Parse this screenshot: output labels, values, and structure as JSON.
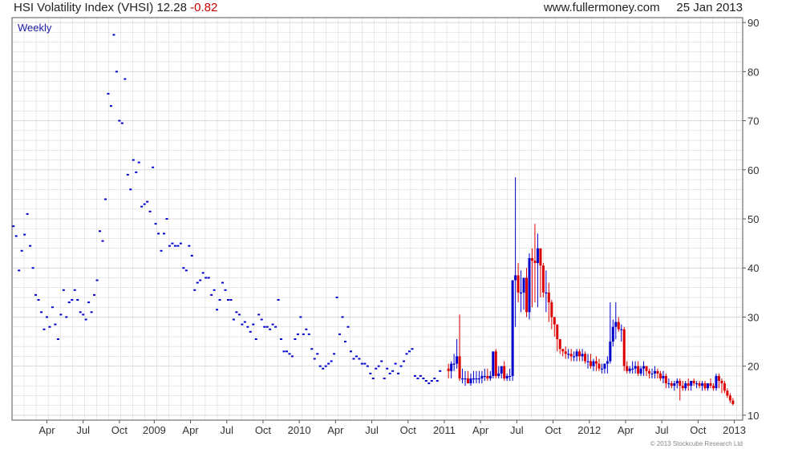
{
  "header": {
    "title": "HSI Volatility Index (VHSI)",
    "last": "12.28",
    "change": "-0.82",
    "source": "www.fullermoney.com",
    "date": "25 Jan 2013"
  },
  "footer": {
    "copyright": "© 2013 Stockcube Research Ltd"
  },
  "colors": {
    "up": "#0000cc",
    "down": "#dd0000",
    "grid": "#d8d8d8",
    "text": "#333333"
  },
  "chart_data": {
    "type": "candlestick",
    "title": "HSI Volatility Index (VHSI)",
    "subtitle": "Weekly",
    "y_axis": {
      "side": "right",
      "ylim": [
        9,
        91
      ],
      "ticks": [
        10,
        20,
        30,
        40,
        50,
        60,
        70,
        80,
        90
      ]
    },
    "x_axis": {
      "labels": [
        "Apr",
        "Jul",
        "Oct",
        "2009",
        "Apr",
        "Jul",
        "Oct",
        "2010",
        "Apr",
        "Jul",
        "Oct",
        "2011",
        "Apr",
        "Jul",
        "Oct",
        "2012",
        "Apr",
        "Jul",
        "Oct",
        "2013"
      ],
      "label_week": [
        12.5,
        25.5,
        38.5,
        51,
        64,
        77,
        90,
        103,
        116,
        129,
        142,
        155,
        168,
        181,
        194,
        207,
        220,
        233,
        246,
        259
      ]
    },
    "grid": true,
    "series_points": {
      "name": "VHSI weekly (point plot)",
      "week_start": 0,
      "values": [
        48.5,
        46.5,
        39.5,
        43.5,
        46.8,
        51,
        44.5,
        40,
        34.5,
        33.5,
        31,
        27.5,
        30,
        28,
        32,
        28.5,
        25.5,
        30.5,
        35.5,
        30,
        33,
        33.5,
        35.5,
        33.5,
        31,
        30.5,
        29.5,
        33,
        31,
        34.5,
        37.5,
        47.5,
        45.5,
        54,
        75.5,
        73,
        87.5,
        80,
        70,
        69.5,
        78.5,
        59,
        56,
        62,
        59.5,
        61.5,
        52.5,
        53,
        53.5,
        51.5,
        60.5,
        49,
        47,
        43.5,
        47,
        50,
        44.5,
        45,
        44.5,
        44.5,
        45,
        40,
        39.5,
        44.5,
        42.5,
        35.5,
        37,
        37.5,
        39,
        38,
        38,
        34.5,
        35.5,
        31.5,
        33.5,
        37,
        35.5,
        33.5,
        33.5,
        29.5,
        31,
        30.5,
        28.5,
        29,
        28,
        27,
        28.5,
        25.5,
        30.5,
        29.5,
        28,
        28,
        27.5,
        28.5,
        28,
        33.5,
        25.5,
        23,
        23,
        22.5,
        22,
        25.5,
        26.5,
        30,
        26.5,
        27.5,
        26.5,
        23.5,
        21.5,
        22.5,
        20,
        19.5,
        20,
        20.5,
        21,
        22.5,
        34,
        26.5,
        30,
        25,
        28,
        23,
        21.5,
        22,
        21.5,
        20.5,
        20.5,
        20,
        18.5,
        17.5,
        19.5,
        20,
        21,
        17.5,
        19.5,
        18.5,
        19,
        20.5,
        18.5,
        20,
        21,
        22.5,
        23,
        23.5,
        18,
        17.5,
        18,
        17.5,
        17,
        16.5,
        17,
        17.5,
        17,
        19
      ]
    },
    "series_candles": {
      "name": "VHSI weekly (OHLC)",
      "week_start": 156,
      "open": [
        19.5,
        19,
        20.5,
        20.5,
        22,
        17.5,
        17.5,
        17.5,
        16.5,
        17.5,
        17.5,
        17.5,
        17.5,
        18,
        18,
        17.5,
        18,
        23,
        18,
        18.5,
        20,
        17.5,
        18,
        18,
        37.5,
        38.5,
        35,
        35,
        38,
        31,
        42,
        41.5,
        41,
        44,
        40.5,
        35,
        35,
        33,
        30,
        28.5,
        25.5,
        23.5,
        23,
        22.5,
        22.5,
        22,
        22,
        23,
        22,
        22.5,
        21,
        21,
        20,
        21,
        20.5,
        19.5,
        19.5,
        20.5,
        21,
        25,
        28,
        29,
        27.5,
        27.5,
        20,
        19,
        19.5,
        19.5,
        20,
        18.5,
        19.5,
        20,
        19,
        18.5,
        18.5,
        19,
        18.5,
        17.5,
        18,
        16.5,
        16.5,
        16,
        16.5,
        17,
        16,
        15.5,
        16.5,
        16,
        17,
        16.5,
        16.5,
        16,
        16.5,
        15.5,
        16.5,
        16,
        15.5,
        18,
        17,
        16.5,
        15,
        14,
        13
      ],
      "high": [
        20.5,
        21,
        22.5,
        25.5,
        30.5,
        19.5,
        19,
        19,
        18.5,
        19,
        19,
        19,
        19,
        19.5,
        19.5,
        19,
        19.5,
        23.5,
        20,
        19.5,
        21,
        18.5,
        19.5,
        19.5,
        58.5,
        41,
        39.5,
        38,
        40,
        43,
        44,
        49,
        47,
        43.5,
        41,
        39.5,
        37,
        33.5,
        29,
        27,
        24.5,
        23.5,
        24,
        23.5,
        23.5,
        23,
        23.5,
        23.5,
        23.5,
        23,
        22.5,
        22.5,
        21.5,
        22,
        21.5,
        20.5,
        20.5,
        22,
        33,
        29.5,
        33,
        30,
        28.5,
        28,
        21,
        20,
        21,
        21,
        21,
        20,
        21,
        20,
        19.5,
        19.5,
        20,
        19.5,
        19,
        19,
        18.5,
        17.5,
        17,
        17,
        17.5,
        17.5,
        17,
        17,
        17.5,
        17,
        17.5,
        17,
        17,
        17,
        17,
        16.5,
        17.5,
        16.5,
        18.5,
        18.5,
        17.5,
        17,
        15.5,
        14.5,
        13.5
      ],
      "low": [
        17.5,
        17.5,
        19,
        19.5,
        17,
        16.5,
        16,
        16.5,
        16,
        16.5,
        16.5,
        16.5,
        16.5,
        17,
        17,
        17,
        17.5,
        17.5,
        17.5,
        17.5,
        17,
        17,
        17,
        17,
        28,
        33,
        31,
        31.5,
        30,
        29.5,
        32,
        33,
        32,
        34,
        34,
        31,
        29,
        27.5,
        26,
        23,
        22.5,
        22,
        21.5,
        21.5,
        21,
        21,
        21,
        21,
        21,
        20.5,
        19.5,
        19.5,
        19,
        19,
        19,
        18.5,
        18.5,
        18.5,
        20.5,
        24,
        25.5,
        27,
        25,
        19,
        18.5,
        18.5,
        18.5,
        18.5,
        18,
        18,
        18,
        18,
        17.5,
        17.5,
        17.5,
        17.5,
        17,
        16.5,
        15.5,
        15.5,
        15.5,
        15,
        15.5,
        13,
        15,
        15,
        15,
        15,
        16,
        15.5,
        15.5,
        15,
        15,
        15,
        15.5,
        15,
        15,
        15.5,
        14.5,
        14.5,
        13.5,
        12.5,
        12
      ],
      "close": [
        19,
        20.5,
        20.5,
        22,
        17.5,
        17.5,
        17.5,
        16.5,
        17.5,
        17.5,
        17.5,
        17.5,
        18,
        18,
        17.5,
        18,
        23,
        18,
        18.5,
        20,
        17.5,
        18,
        18,
        37.5,
        38.5,
        35,
        35,
        38,
        31,
        42,
        41.5,
        41,
        44,
        40.5,
        35,
        35,
        33,
        30,
        28.5,
        25.5,
        23.5,
        23,
        22.5,
        22.5,
        22,
        22,
        23,
        22,
        22.5,
        21,
        21,
        20,
        21,
        20.5,
        19.5,
        19.5,
        20.5,
        21,
        25,
        28,
        29,
        27.5,
        27.5,
        20,
        19,
        19.5,
        19.5,
        20,
        18.5,
        19.5,
        20,
        19,
        18.5,
        18.5,
        19,
        18.5,
        17.5,
        18,
        16.5,
        16.5,
        16,
        16.5,
        17,
        16,
        15.5,
        16.5,
        16,
        17,
        16.5,
        16.5,
        16,
        16.5,
        15.5,
        16.5,
        16,
        15.5,
        18,
        17,
        16.5,
        15,
        14,
        13,
        12.28
      ]
    }
  }
}
